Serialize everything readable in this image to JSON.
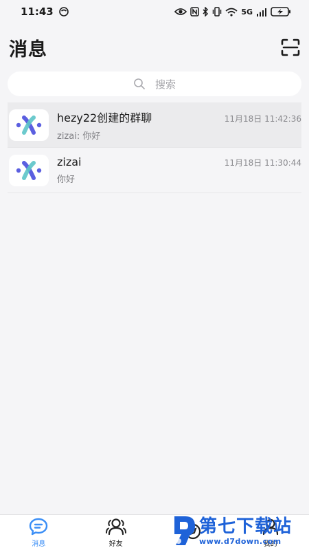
{
  "status_bar": {
    "time": "11:43",
    "network_label": "5G",
    "colors": {
      "text": "#1a1a1a"
    }
  },
  "header": {
    "title": "消息",
    "scan_icon": "scan-icon"
  },
  "search": {
    "placeholder": "搜索"
  },
  "conversations": [
    {
      "name": "hezy22创建的群聊",
      "time": "11月18日 11:42:36",
      "preview": "zizai: 你好",
      "active": true
    },
    {
      "name": "zizai",
      "time": "11月18日 11:30:44",
      "preview": "你好",
      "active": false
    }
  ],
  "tabs": [
    {
      "label": "消息",
      "icon": "message-icon",
      "active": true
    },
    {
      "label": "好友",
      "icon": "friends-icon",
      "active": false
    },
    {
      "label": "",
      "icon": "discover-icon",
      "active": false
    },
    {
      "label": "我的",
      "icon": "profile-icon",
      "active": false
    }
  ],
  "watermark": {
    "name": "第七下载站",
    "url": "www.d7down.com"
  },
  "colors": {
    "accent": "#3a8ef6",
    "background": "#f5f5f7",
    "logo_purple": "#5b5fe0",
    "logo_teal": "#5cc4c8"
  }
}
